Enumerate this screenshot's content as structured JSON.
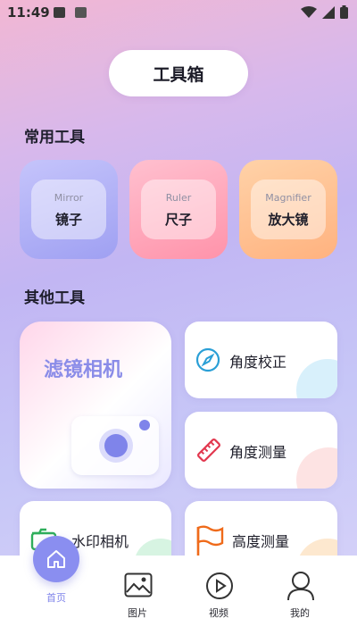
{
  "status_bar": {
    "time": "11:49"
  },
  "header": {
    "title": "工具箱"
  },
  "sections": {
    "common": "常用工具",
    "other": "其他工具"
  },
  "common_tools": [
    {
      "en": "Mirror",
      "zh": "镜子",
      "color": "#a8a8f5"
    },
    {
      "en": "Ruler",
      "zh": "尺子",
      "color": "#ff9fb6"
    },
    {
      "en": "Magnifier",
      "zh": "放大镜",
      "color": "#ffbf8f"
    }
  ],
  "other_tools": {
    "filter_camera": "滤镜相机",
    "angle_correct": "角度校正",
    "angle_measure": "角度测量",
    "watermark_camera": "水印相机",
    "height_measure": "高度测量"
  },
  "tabbar": {
    "home": "首页",
    "pictures": "图片",
    "video": "视频",
    "mine": "我的"
  },
  "colors": {
    "accent": "#8a8ef0"
  }
}
